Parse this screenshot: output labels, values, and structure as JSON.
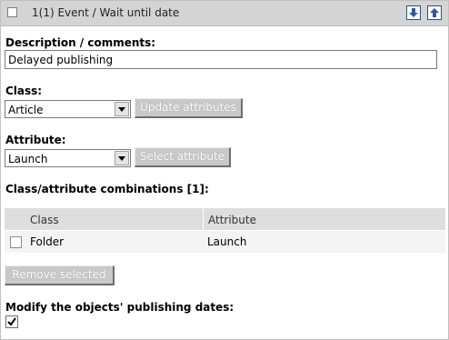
{
  "header": {
    "title": "1(1) Event / Wait until date",
    "move_down_icon": "arrow-down-icon",
    "move_up_icon": "arrow-up-icon"
  },
  "description": {
    "label": "Description / comments:",
    "value": "Delayed publishing"
  },
  "class_section": {
    "label": "Class:",
    "selected": "Article",
    "button": "Update attributes"
  },
  "attribute_section": {
    "label": "Attribute:",
    "selected": "Launch",
    "button": "Select attribute"
  },
  "combinations": {
    "label": "Class/attribute combinations [1]:",
    "columns": [
      "Class",
      "Attribute"
    ],
    "rows": [
      {
        "class": "Folder",
        "attribute": "Launch"
      }
    ],
    "remove_button": "Remove selected"
  },
  "modify_dates": {
    "label": "Modify the objects' publishing dates:",
    "checked": true
  },
  "colors": {
    "header_bg": "#d4d4d4",
    "button_bg": "#c9c9c9",
    "table_head_bg": "#dedede",
    "table_row_bg": "#f4f4f4",
    "arrow_icon": "#2f5a9c"
  }
}
